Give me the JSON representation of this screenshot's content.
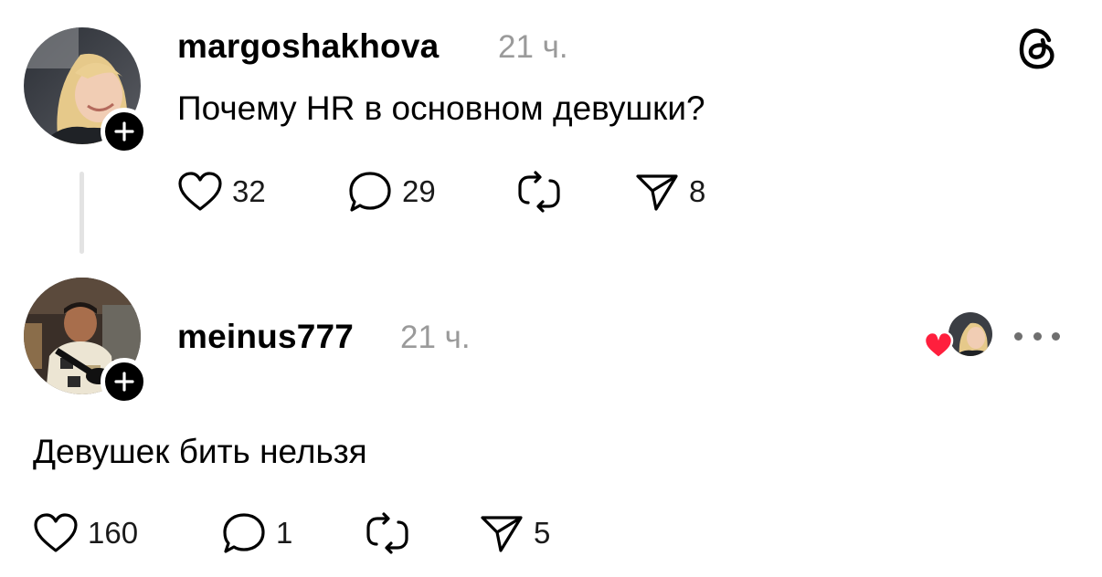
{
  "post": {
    "author": {
      "username": "margoshakhova",
      "avatar_icon": "profile-photo-woman-blonde",
      "follow_icon": "plus-icon"
    },
    "time": "21 ч.",
    "text": "Почему HR в основном девушки?",
    "stats": {
      "likes": "32",
      "replies": "29",
      "reposts": "",
      "shares": "8"
    }
  },
  "reply": {
    "author": {
      "username": "meinus777",
      "avatar_icon": "profile-photo-man",
      "follow_icon": "plus-icon"
    },
    "time": "21 ч.",
    "text": "Девушек бить нельзя",
    "liked_by_author": true,
    "liked_icon": "heart-icon",
    "stats": {
      "likes": "160",
      "replies": "1",
      "reposts": "",
      "shares": "5"
    }
  },
  "app": {
    "logo_icon": "threads-logo-icon",
    "more_icon": "more-dots-icon"
  },
  "colors": {
    "text": "#000000",
    "muted": "#9a9a9a",
    "thread_line": "#e3e3e3",
    "heart_red": "#ff1f3d"
  }
}
